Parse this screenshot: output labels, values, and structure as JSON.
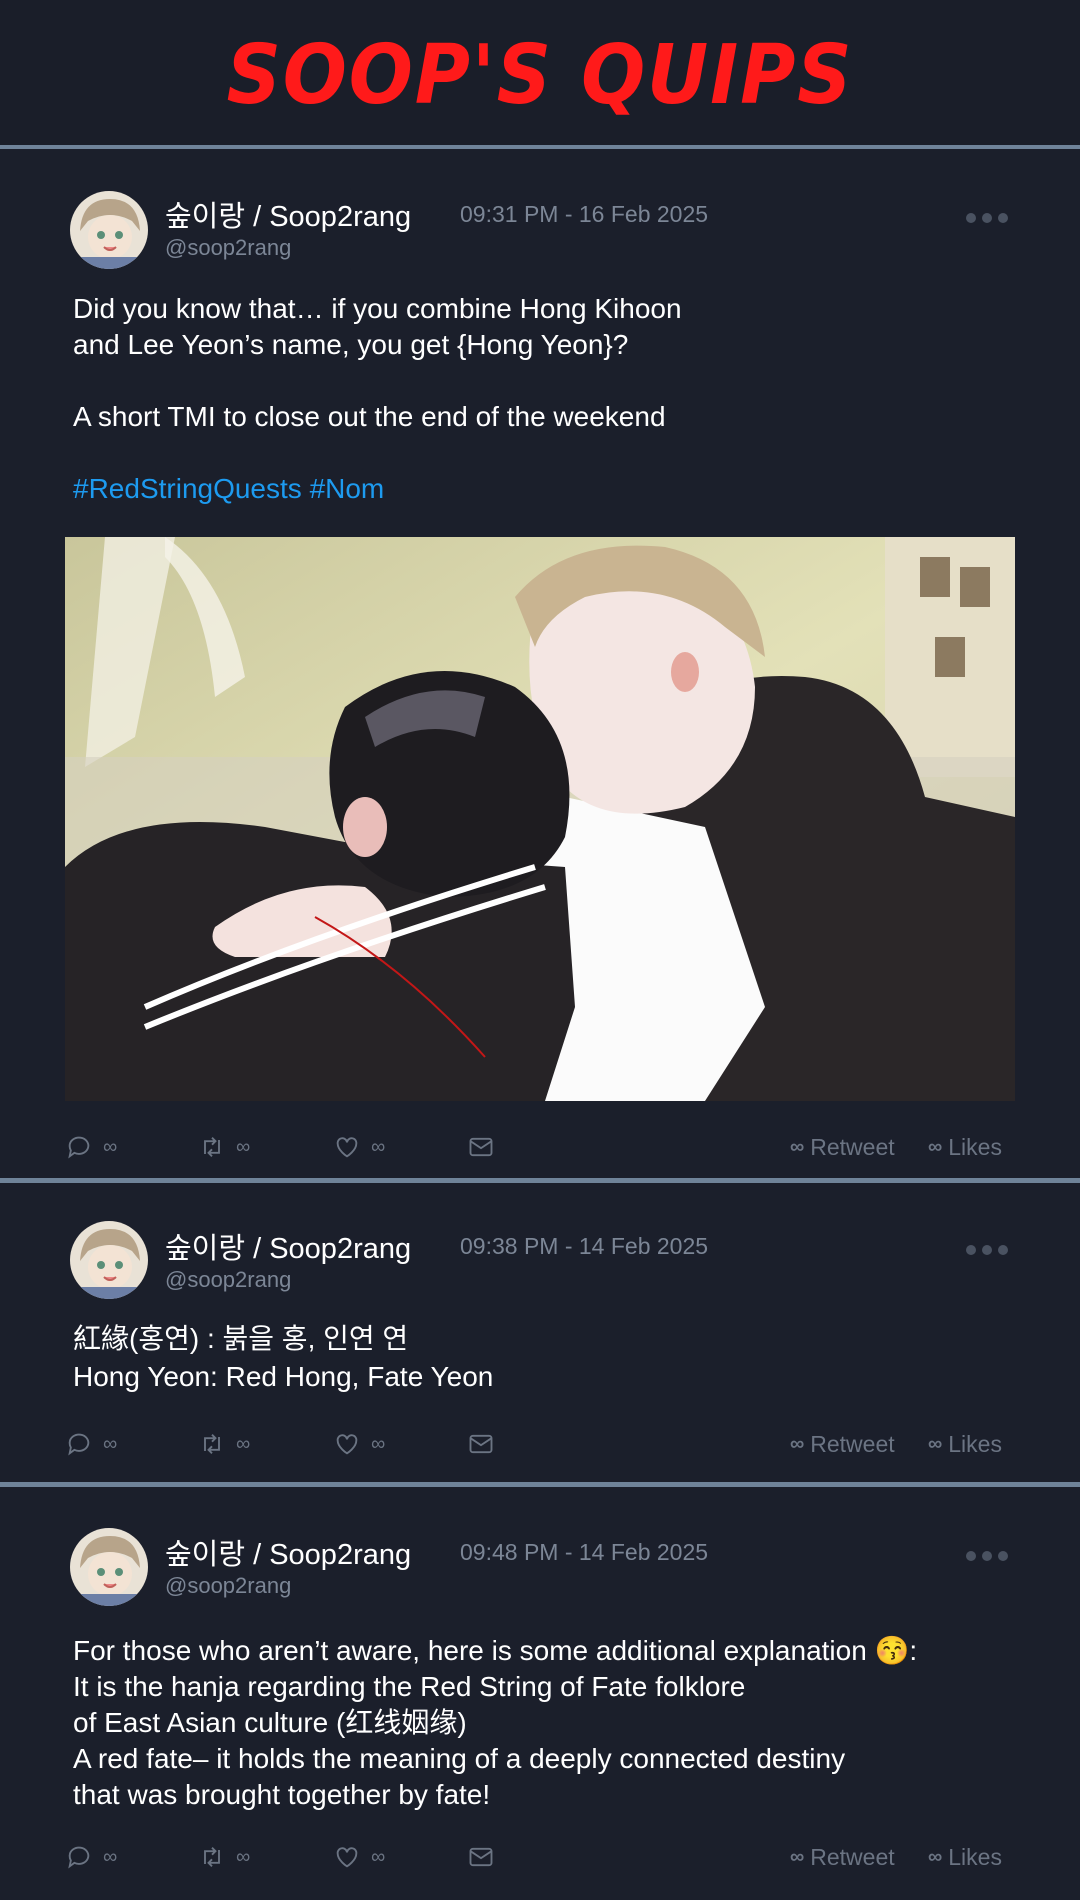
{
  "header": {
    "title": "SOOP'S QUIPS",
    "title_color": "#ff1a1a"
  },
  "tweets": [
    {
      "display_name": "숲이랑 / Soop2rang",
      "handle": "@soop2rang",
      "timestamp": "09:31 PM - 16 Feb 2025",
      "lines": [
        "Did you know that… if you combine Hong Kihoon",
        "and Lee Yeon’s name, you get {Hong Yeon}?",
        "A short TMI to close out the end of the weekend"
      ],
      "hashtags": "#RedStringQuests #Nom",
      "has_image": true
    },
    {
      "display_name": "숲이랑 / Soop2rang",
      "handle": "@soop2rang",
      "timestamp": "09:38 PM - 14 Feb 2025",
      "lines": [
        "紅緣(홍연) : 붉을 홍, 인연 연",
        "Hong Yeon: Red Hong, Fate Yeon"
      ]
    },
    {
      "display_name": "숲이랑 / Soop2rang",
      "handle": "@soop2rang",
      "timestamp": "09:48 PM - 14 Feb 2025",
      "lines": [
        "For those who aren’t aware, here is some additional explanation 😚:",
        "It is the hanja regarding the Red String of Fate folklore",
        "of East Asian culture (红线姻缘)",
        "A red fate– it holds the meaning of a deeply connected destiny",
        "that was brought together by fate!"
      ]
    }
  ],
  "actions": {
    "reply_count": "∞",
    "retweet_count": "∞",
    "like_count": "∞",
    "retweet_label": "Retweet",
    "likes_label": "Likes",
    "infinity": "∞"
  },
  "icons": [
    "reply-icon",
    "retweet-icon",
    "heart-icon",
    "mail-icon",
    "more-dots-icon"
  ],
  "colors": {
    "background": "#1b1f2b",
    "divider": "#6f8399",
    "hashtag": "#1d9bf0",
    "muted": "#7c8696"
  }
}
